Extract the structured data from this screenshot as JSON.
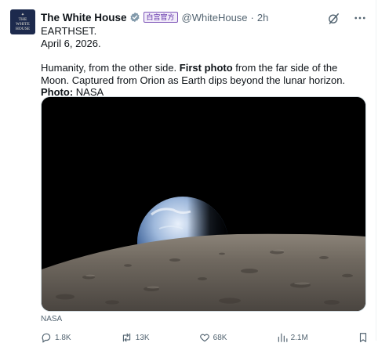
{
  "post": {
    "author_name": "The White House",
    "avatar_text": "THE WHITE HOUSE",
    "affiliation_label": "白宫官方",
    "handle": "@WhiteHouse",
    "separator": "·",
    "time": "2h",
    "line1": "EARTHSET.",
    "line2": "April 6, 2026.",
    "p_a": "Humanity, from the other side. ",
    "p_b": "First photo",
    "p_c": " from the far side of the Moon. Captured from Orion as Earth dips beyond the lunar horizon. ",
    "p_d": "Photo:",
    "p_e": " NASA",
    "media_caption": "NASA"
  },
  "actions": {
    "replies": "1.8K",
    "reposts": "13K",
    "likes": "68K",
    "views": "2.1M"
  },
  "icons": {
    "verified": "verified-badge-icon",
    "grok": "grok-icon",
    "more": "more-icon",
    "reply": "reply-icon",
    "repost": "repost-icon",
    "like": "heart-icon",
    "views": "views-icon",
    "bookmark": "bookmark-icon"
  },
  "colors": {
    "text": "#0f1419",
    "muted": "#536471",
    "verified_gray": "#829aab",
    "affiliation_purple": "#5b2aa6"
  }
}
